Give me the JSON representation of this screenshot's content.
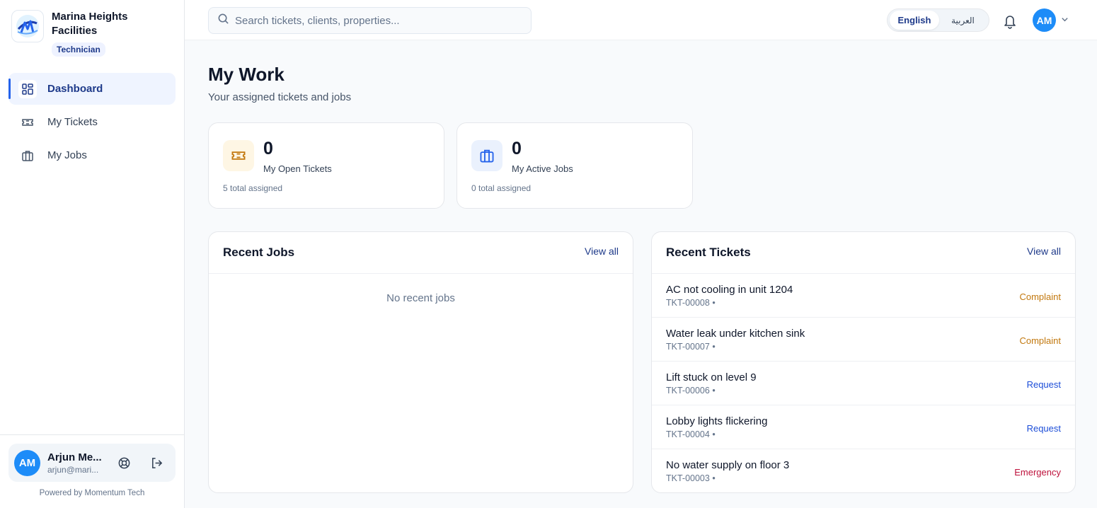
{
  "brand": {
    "name": "Marina Heights Facilities",
    "role": "Technician"
  },
  "nav": [
    {
      "label": "Dashboard",
      "icon": "dashboard-icon",
      "active": true
    },
    {
      "label": "My Tickets",
      "icon": "ticket-icon",
      "active": false
    },
    {
      "label": "My Jobs",
      "icon": "briefcase-icon",
      "active": false
    }
  ],
  "user": {
    "initials": "AM",
    "name": "Arjun Me...",
    "email": "arjun@mari..."
  },
  "footer": {
    "powered_by": "Powered by Momentum Tech"
  },
  "search": {
    "placeholder": "Search tickets, clients, properties..."
  },
  "language": {
    "active": "English",
    "inactive": "العربية"
  },
  "page": {
    "title": "My Work",
    "subtitle": "Your assigned tickets and jobs"
  },
  "stats": [
    {
      "value": "0",
      "label": "My Open Tickets",
      "meta": "5 total assigned",
      "icon": "ticket-icon"
    },
    {
      "value": "0",
      "label": "My Active Jobs",
      "meta": "0 total assigned",
      "icon": "briefcase-icon"
    }
  ],
  "recent_jobs": {
    "title": "Recent Jobs",
    "view_all": "View all",
    "empty": "No recent jobs"
  },
  "recent_tickets": {
    "title": "Recent Tickets",
    "view_all": "View all",
    "items": [
      {
        "title": "AC not cooling in unit 1204",
        "id": "TKT-00008 •",
        "type": "Complaint"
      },
      {
        "title": "Water leak under kitchen sink",
        "id": "TKT-00007 •",
        "type": "Complaint"
      },
      {
        "title": "Lift stuck on level 9",
        "id": "TKT-00006 •",
        "type": "Request"
      },
      {
        "title": "Lobby lights flickering",
        "id": "TKT-00004 •",
        "type": "Request"
      },
      {
        "title": "No water supply on floor 3",
        "id": "TKT-00003 •",
        "type": "Emergency"
      }
    ]
  },
  "colors": {
    "accent": "#2563eb",
    "complaint": "#c2780e",
    "request": "#1d4ed8",
    "emergency": "#be123c",
    "ticket_icon_bg": "#fef6e4",
    "job_icon_bg": "#eaf1fd"
  }
}
